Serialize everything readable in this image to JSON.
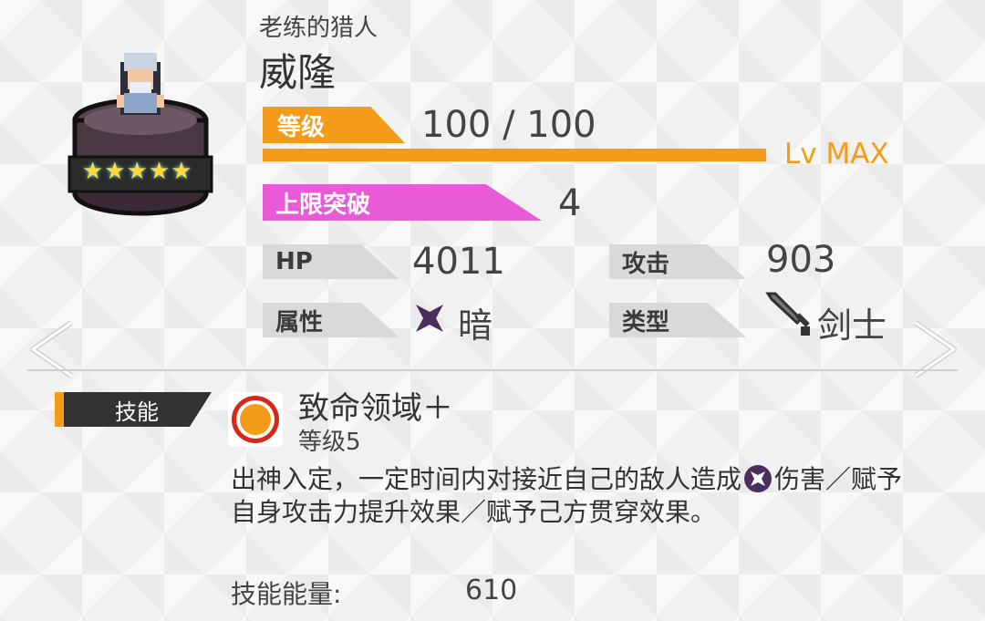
{
  "character": {
    "subtitle": "老练的猎人",
    "name": "威隆",
    "stars": "★★★★★"
  },
  "level": {
    "label": "等级",
    "value": "100 / 100",
    "max_text": "Lv MAX",
    "progress": 1.0
  },
  "limit_break": {
    "label": "上限突破",
    "value": "4"
  },
  "stats": {
    "hp_label": "HP",
    "hp_value": "4011",
    "attack_label": "攻击",
    "attack_value": "903",
    "attribute_label": "属性",
    "attribute_value": "暗",
    "type_label": "类型",
    "type_value": "剑士"
  },
  "skill": {
    "tab_label": "技能",
    "name": "致命领域＋",
    "level": "等级5",
    "desc_part1": "出神入定，一定时间内对接近自己的敌人造成",
    "desc_part2": "伤害／赋予自身攻击力提升效果／赋予己方贯穿效果。",
    "energy_label": "技能能量:",
    "energy_value": "610"
  },
  "colors": {
    "accent_orange": "#f49c19",
    "accent_pink": "#e95ad6",
    "dark_attribute": "#4a2f5c"
  },
  "icons": {
    "prev": "chevron-left-icon",
    "next": "chevron-right-icon",
    "dark": "dark-attribute-icon",
    "sword": "sword-icon",
    "skill": "skill-orb-icon"
  }
}
